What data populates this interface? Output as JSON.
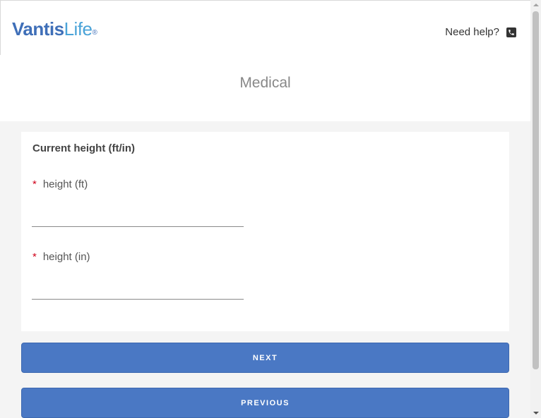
{
  "header": {
    "logo_brand": "Vantis",
    "logo_suffix": "Life",
    "logo_mark": "®",
    "help_text": "Need help?",
    "help_icon": "phone-icon"
  },
  "page": {
    "title": "Medical"
  },
  "form": {
    "section_title": "Current height (ft/in)",
    "fields": [
      {
        "required_mark": "*",
        "label": "height (ft)",
        "value": ""
      },
      {
        "required_mark": "*",
        "label": "height (in)",
        "value": ""
      }
    ]
  },
  "buttons": {
    "next": "NEXT",
    "previous": "PREVIOUS"
  },
  "colors": {
    "brand_blue": "#3f6fb8",
    "brand_light_blue": "#4aa3d8",
    "button_blue": "#4a78c4",
    "required_red": "#d0021b"
  }
}
